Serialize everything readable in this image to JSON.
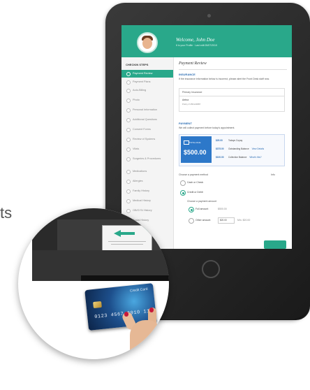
{
  "side_text": "ts",
  "header": {
    "welcome": "Welcome, John Doe",
    "subline": "It is your Profile · Last edit 05/07/2019"
  },
  "sidebar": {
    "heading": "CHECKIN STEPS",
    "items": [
      {
        "label": "Payment Review"
      },
      {
        "label": "Payment Plans"
      },
      {
        "label": "Auto-Billing"
      },
      {
        "label": "Photo"
      },
      {
        "label": "Personal Information"
      },
      {
        "label": "Additional Questions"
      },
      {
        "label": "Consent Forms"
      },
      {
        "label": "Review of Systems"
      },
      {
        "label": "Vitals"
      },
      {
        "label": "Surgeries & Procedures"
      },
      {
        "label": "Medications"
      },
      {
        "label": "Allergies"
      },
      {
        "label": "Family History"
      },
      {
        "label": "Medical History"
      },
      {
        "label": "OB/GYN History"
      },
      {
        "label": "Social History"
      }
    ]
  },
  "main": {
    "title": "Payment Review",
    "insurance": {
      "heading": "INSURANCE",
      "note": "If the insurance information below is incorrect, please alert the Front Desk staff now.",
      "card_header": "Primary Insurance",
      "name": "Aetna",
      "policy": "Policy # 456123887"
    },
    "payment": {
      "heading": "PAYMENT",
      "note": "We will collect payment before today's appointment.",
      "tile_caption": "TOTAL DUE",
      "total": "$500.00",
      "lines": [
        {
          "value": "$25.00",
          "label": "Todays Copay",
          "link": ""
        },
        {
          "value": "$375.00",
          "label": "Outstanding Balance",
          "link": "View Details"
        },
        {
          "value": "$100.00",
          "label": "Collection Balance",
          "link": "What's this?"
        }
      ]
    },
    "method": {
      "question": "Choose a payment method",
      "hint": "Info",
      "cash": "Cash or Check",
      "credit": "Credit or Debit",
      "amount_question": "Choose a payment amount",
      "full": "Full amount",
      "full_value": "$500.00",
      "other": "Other amount",
      "other_value": "$20.00",
      "min": "Min. $20.00"
    }
  },
  "reader": {
    "card_title": "Credit Card",
    "card_number": "0123 4567 8910 11"
  },
  "colors": {
    "brand": "#29a88a",
    "accent": "#2d78c9"
  }
}
